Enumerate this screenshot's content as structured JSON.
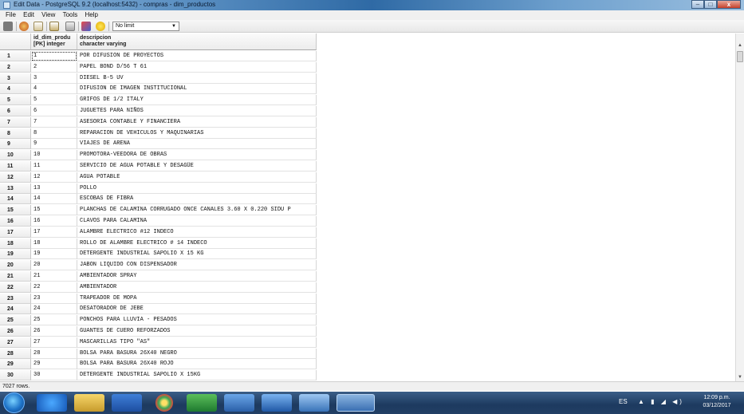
{
  "window": {
    "title": "Edit Data - PostgreSQL 9.2 (localhost:5432) - compras - dim_productos",
    "minimize_label": "–",
    "maximize_label": "□",
    "close_label": "x"
  },
  "menu": {
    "items": [
      "File",
      "Edit",
      "View",
      "Tools",
      "Help"
    ]
  },
  "toolbar": {
    "icons": [
      "save-icon",
      "refresh-icon",
      "copy-icon",
      "paste-icon",
      "delete-icon",
      "filter-icon",
      "help-icon"
    ],
    "limit_value": "No limit"
  },
  "grid": {
    "columns": [
      {
        "name": "id_dim_produ",
        "type": "[PK] integer"
      },
      {
        "name": "descripcion",
        "type": "character varying"
      }
    ],
    "rows": [
      {
        "n": "1",
        "id": "1",
        "desc": "POR DIFUSION DE PROYECTOS"
      },
      {
        "n": "2",
        "id": "2",
        "desc": "PAPEL BOND D/56 T 61"
      },
      {
        "n": "3",
        "id": "3",
        "desc": "DIESEL B-5 UV"
      },
      {
        "n": "4",
        "id": "4",
        "desc": "DIFUSION DE IMAGEN INSTITUCIONAL"
      },
      {
        "n": "5",
        "id": "5",
        "desc": "GRIFOS DE 1/2 ITALY"
      },
      {
        "n": "6",
        "id": "6",
        "desc": "JUGUETES PARA NIÑOS"
      },
      {
        "n": "7",
        "id": "7",
        "desc": "ASESORIA CONTABLE Y FINANCIERA"
      },
      {
        "n": "8",
        "id": "8",
        "desc": "REPARACION DE VEHICULOS Y MAQUINARIAS"
      },
      {
        "n": "9",
        "id": "9",
        "desc": "VIAJES DE ARENA"
      },
      {
        "n": "10",
        "id": "10",
        "desc": "PROMOTORA-VEEDORA DE OBRAS"
      },
      {
        "n": "11",
        "id": "11",
        "desc": "SERVICIO DE AGUA POTABLE Y DESAGÜE"
      },
      {
        "n": "12",
        "id": "12",
        "desc": "AGUA POTABLE"
      },
      {
        "n": "13",
        "id": "13",
        "desc": "POLLO"
      },
      {
        "n": "14",
        "id": "14",
        "desc": "ESCOBAS DE FIBRA"
      },
      {
        "n": "15",
        "id": "15",
        "desc": "PLANCHAS DE CALAMINA CORRUGADO ONCE CANALES 3.60 X 0.220 SIDU P"
      },
      {
        "n": "16",
        "id": "16",
        "desc": "CLAVOS PARA CALAMINA"
      },
      {
        "n": "17",
        "id": "17",
        "desc": "ALAMBRE ELECTRICO #12 INDECO"
      },
      {
        "n": "18",
        "id": "18",
        "desc": "ROLLO DE ALAMBRE ELECTRICO # 14 INDECO"
      },
      {
        "n": "19",
        "id": "19",
        "desc": "DETERGENTE INDUSTRIAL SAPOLIO  X 15 KG"
      },
      {
        "n": "20",
        "id": "20",
        "desc": "JABON LIQUIDO CON DISPENSADOR"
      },
      {
        "n": "21",
        "id": "21",
        "desc": "AMBIENTADOR SPRAY"
      },
      {
        "n": "22",
        "id": "22",
        "desc": "AMBIENTADOR"
      },
      {
        "n": "23",
        "id": "23",
        "desc": "TRAPEADOR DE MOPA"
      },
      {
        "n": "24",
        "id": "24",
        "desc": "DESATORADOR DE JEBE"
      },
      {
        "n": "25",
        "id": "25",
        "desc": "PONCHOS PARA LLUVIA - PESADOS"
      },
      {
        "n": "26",
        "id": "26",
        "desc": "GUANTES DE CUERO REFORZADOS"
      },
      {
        "n": "27",
        "id": "27",
        "desc": "MASCARILLAS TIPO \"AS\""
      },
      {
        "n": "28",
        "id": "28",
        "desc": "BOLSA PARA BASURA 26X40 NEGRO"
      },
      {
        "n": "29",
        "id": "29",
        "desc": "BOLSA PARA BASURA 26X40 ROJO"
      },
      {
        "n": "30",
        "id": "30",
        "desc": "DETERGENTE INDUSTRIAL SAPOLIO X 15KG"
      }
    ]
  },
  "status": {
    "text": "7027 rows."
  },
  "taskbar": {
    "apps": [
      "ie-icon",
      "explorer-icon",
      "media-icon",
      "chrome-icon",
      "excel-icon",
      "app-icon",
      "virtualbox-icon",
      "tools-icon",
      "pgadmin-icon"
    ],
    "language": "ES",
    "time": "12:09 p.m.",
    "date": "03/12/2017"
  }
}
